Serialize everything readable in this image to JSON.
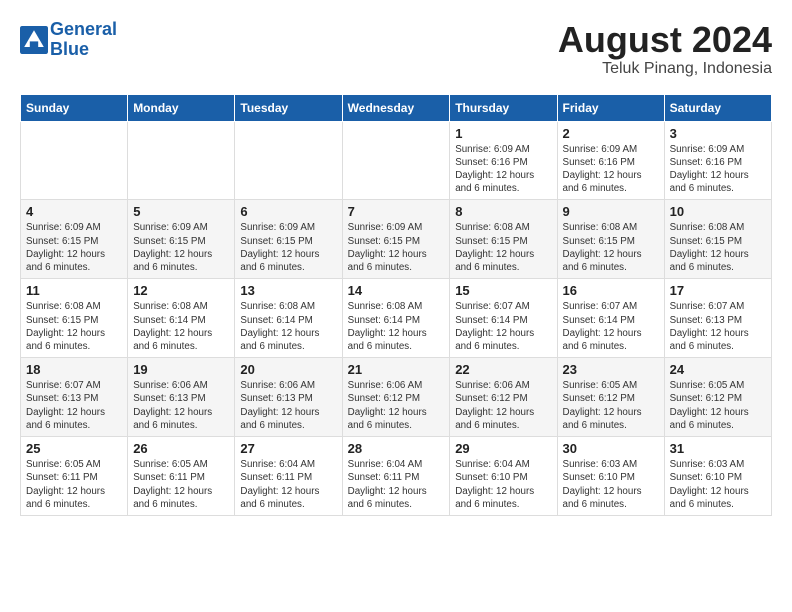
{
  "logo": {
    "line1": "General",
    "line2": "Blue"
  },
  "title": "August 2024",
  "subtitle": "Teluk Pinang, Indonesia",
  "weekdays": [
    "Sunday",
    "Monday",
    "Tuesday",
    "Wednesday",
    "Thursday",
    "Friday",
    "Saturday"
  ],
  "weeks": [
    [
      {
        "day": "",
        "info": ""
      },
      {
        "day": "",
        "info": ""
      },
      {
        "day": "",
        "info": ""
      },
      {
        "day": "",
        "info": ""
      },
      {
        "day": "1",
        "info": "Sunrise: 6:09 AM\nSunset: 6:16 PM\nDaylight: 12 hours\nand 6 minutes."
      },
      {
        "day": "2",
        "info": "Sunrise: 6:09 AM\nSunset: 6:16 PM\nDaylight: 12 hours\nand 6 minutes."
      },
      {
        "day": "3",
        "info": "Sunrise: 6:09 AM\nSunset: 6:16 PM\nDaylight: 12 hours\nand 6 minutes."
      }
    ],
    [
      {
        "day": "4",
        "info": "Sunrise: 6:09 AM\nSunset: 6:15 PM\nDaylight: 12 hours\nand 6 minutes."
      },
      {
        "day": "5",
        "info": "Sunrise: 6:09 AM\nSunset: 6:15 PM\nDaylight: 12 hours\nand 6 minutes."
      },
      {
        "day": "6",
        "info": "Sunrise: 6:09 AM\nSunset: 6:15 PM\nDaylight: 12 hours\nand 6 minutes."
      },
      {
        "day": "7",
        "info": "Sunrise: 6:09 AM\nSunset: 6:15 PM\nDaylight: 12 hours\nand 6 minutes."
      },
      {
        "day": "8",
        "info": "Sunrise: 6:08 AM\nSunset: 6:15 PM\nDaylight: 12 hours\nand 6 minutes."
      },
      {
        "day": "9",
        "info": "Sunrise: 6:08 AM\nSunset: 6:15 PM\nDaylight: 12 hours\nand 6 minutes."
      },
      {
        "day": "10",
        "info": "Sunrise: 6:08 AM\nSunset: 6:15 PM\nDaylight: 12 hours\nand 6 minutes."
      }
    ],
    [
      {
        "day": "11",
        "info": "Sunrise: 6:08 AM\nSunset: 6:15 PM\nDaylight: 12 hours\nand 6 minutes."
      },
      {
        "day": "12",
        "info": "Sunrise: 6:08 AM\nSunset: 6:14 PM\nDaylight: 12 hours\nand 6 minutes."
      },
      {
        "day": "13",
        "info": "Sunrise: 6:08 AM\nSunset: 6:14 PM\nDaylight: 12 hours\nand 6 minutes."
      },
      {
        "day": "14",
        "info": "Sunrise: 6:08 AM\nSunset: 6:14 PM\nDaylight: 12 hours\nand 6 minutes."
      },
      {
        "day": "15",
        "info": "Sunrise: 6:07 AM\nSunset: 6:14 PM\nDaylight: 12 hours\nand 6 minutes."
      },
      {
        "day": "16",
        "info": "Sunrise: 6:07 AM\nSunset: 6:14 PM\nDaylight: 12 hours\nand 6 minutes."
      },
      {
        "day": "17",
        "info": "Sunrise: 6:07 AM\nSunset: 6:13 PM\nDaylight: 12 hours\nand 6 minutes."
      }
    ],
    [
      {
        "day": "18",
        "info": "Sunrise: 6:07 AM\nSunset: 6:13 PM\nDaylight: 12 hours\nand 6 minutes."
      },
      {
        "day": "19",
        "info": "Sunrise: 6:06 AM\nSunset: 6:13 PM\nDaylight: 12 hours\nand 6 minutes."
      },
      {
        "day": "20",
        "info": "Sunrise: 6:06 AM\nSunset: 6:13 PM\nDaylight: 12 hours\nand 6 minutes."
      },
      {
        "day": "21",
        "info": "Sunrise: 6:06 AM\nSunset: 6:12 PM\nDaylight: 12 hours\nand 6 minutes."
      },
      {
        "day": "22",
        "info": "Sunrise: 6:06 AM\nSunset: 6:12 PM\nDaylight: 12 hours\nand 6 minutes."
      },
      {
        "day": "23",
        "info": "Sunrise: 6:05 AM\nSunset: 6:12 PM\nDaylight: 12 hours\nand 6 minutes."
      },
      {
        "day": "24",
        "info": "Sunrise: 6:05 AM\nSunset: 6:12 PM\nDaylight: 12 hours\nand 6 minutes."
      }
    ],
    [
      {
        "day": "25",
        "info": "Sunrise: 6:05 AM\nSunset: 6:11 PM\nDaylight: 12 hours\nand 6 minutes."
      },
      {
        "day": "26",
        "info": "Sunrise: 6:05 AM\nSunset: 6:11 PM\nDaylight: 12 hours\nand 6 minutes."
      },
      {
        "day": "27",
        "info": "Sunrise: 6:04 AM\nSunset: 6:11 PM\nDaylight: 12 hours\nand 6 minutes."
      },
      {
        "day": "28",
        "info": "Sunrise: 6:04 AM\nSunset: 6:11 PM\nDaylight: 12 hours\nand 6 minutes."
      },
      {
        "day": "29",
        "info": "Sunrise: 6:04 AM\nSunset: 6:10 PM\nDaylight: 12 hours\nand 6 minutes."
      },
      {
        "day": "30",
        "info": "Sunrise: 6:03 AM\nSunset: 6:10 PM\nDaylight: 12 hours\nand 6 minutes."
      },
      {
        "day": "31",
        "info": "Sunrise: 6:03 AM\nSunset: 6:10 PM\nDaylight: 12 hours\nand 6 minutes."
      }
    ]
  ]
}
